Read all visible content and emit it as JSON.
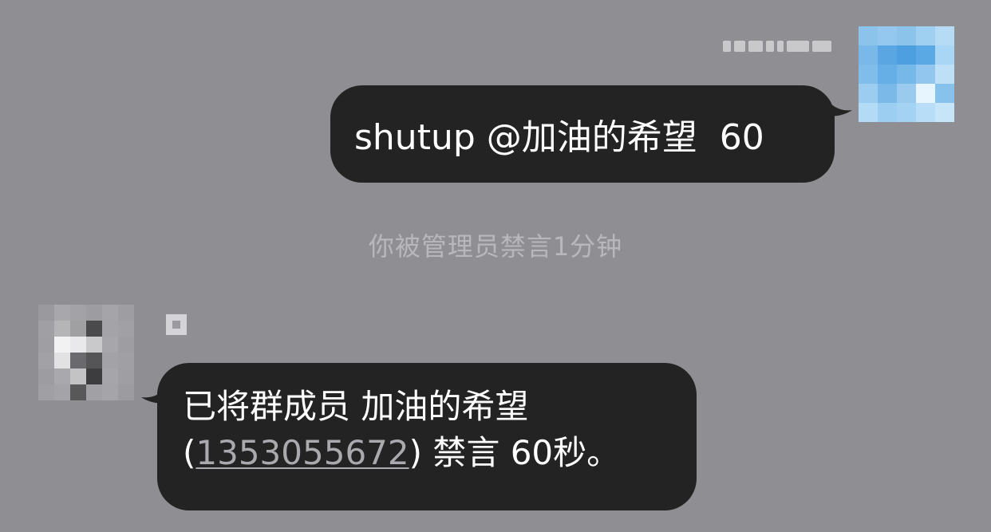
{
  "colors": {
    "background": "#8e8e93",
    "bubble": "#232323",
    "bubble_text": "#ffffff",
    "system_text": "#b8b8bc",
    "link_text": "#a9a9ae"
  },
  "messages": [
    {
      "direction": "outgoing",
      "sender_avatar": "avatar-blurred-blue",
      "text": "shutup @加油的希望  60"
    },
    {
      "direction": "incoming",
      "sender_avatar": "avatar-blurred-gray",
      "line1": "已将群成员 加油的希望",
      "open_paren": "(",
      "qq_number": "1353055672",
      "line2_rest": ") 禁言 60秒。"
    }
  ],
  "system_notice": "你被管理员禁言1分钟"
}
